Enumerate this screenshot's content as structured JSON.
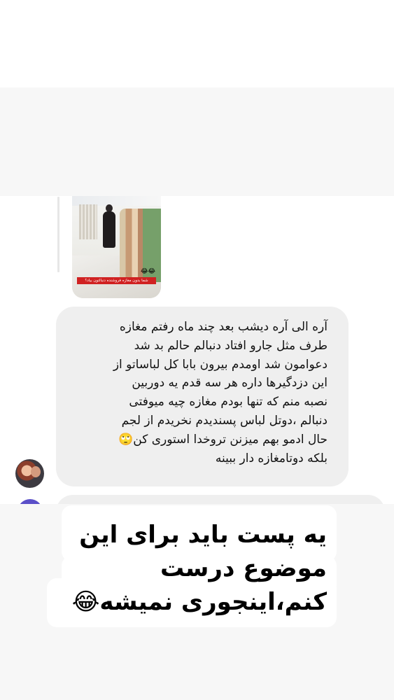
{
  "story_reply": {
    "caption": "شما بدون مغازه فروشنده دنبالتون بیاد؟",
    "caption_emoji": "😂😂"
  },
  "message": {
    "text": "آره الی آره دیشب بعد چند ماه رفتم مغازه\nطرف مثل جارو افتاد دنبالم حالم بد شد\nدعوامون شد اومدم بیرون بابا کل لباساتو از\nاین دزدگیرها داره هر سه قدم یه دوربین\nنصبه منم که تنها بودم مغازه چیه میوفتی\nدنبالم ،دوتل لباس پسندیدم نخریدم از لجم\nحال ادمو بهم میزنن تروخدا استوری کن🙄\nبلکه دوتامغازه دار ببینه"
  },
  "sticker": {
    "text": "یه پست باید برای این\nموضوع درست\nکنم،اینجوری نمیشه😂"
  },
  "colors": {
    "bubble_background": "#efefef",
    "page_background": "#ffffff",
    "overlay_background": "#f7f7f7",
    "caption_red": "#d02121"
  }
}
